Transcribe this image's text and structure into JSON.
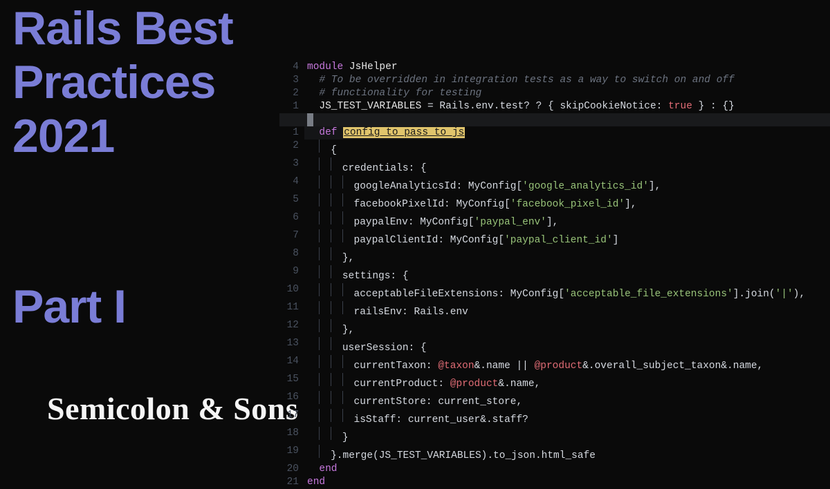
{
  "title": {
    "line1": "Rails Best",
    "line2": "Practices",
    "line3": "2021"
  },
  "part": "Part I",
  "brand": "Semicolon & Sons",
  "code": {
    "module_kw": "module",
    "module_name": " JsHelper",
    "comment1": "  # To be overridden in integration tests as a way to switch on and off",
    "comment2": "  # functionality for testing",
    "const_name": "  JS_TEST_VARIABLES",
    "const_assign": " = Rails.env.test? ? { ",
    "skip_key": "skipCookieNotice:",
    "true_val": " true",
    "const_tail": " } : {}",
    "def_kw": "def",
    "def_name": "config_to_pass_to_js",
    "open_brace": "{",
    "cred_key": "credentials:",
    "brace_open": " {",
    "ga_key": "googleAnalyticsId:",
    "ga_val": " MyConfig[",
    "ga_str": "'google_analytics_id'",
    "fb_key": "facebookPixelId:",
    "fb_str": "'facebook_pixel_id'",
    "pp_key": "paypalEnv:",
    "pp_str": "'paypal_env'",
    "pc_key": "paypalClientId:",
    "pc_str": "'paypal_client_id'",
    "close_brace_c": "},",
    "settings_key": "settings:",
    "afe_key": "acceptableFileExtensions:",
    "afe_str": "'acceptable_file_extensions'",
    "afe_join": "].join(",
    "pipe_str": "'|'",
    "re_key": "railsEnv:",
    "re_val": " Rails.env",
    "us_key": "userSession:",
    "ct_key": "currentTaxon:",
    "taxon_ivar": " @taxon",
    "amp_name": "&.name || ",
    "product_ivar": "@product",
    "overall": "&.overall_subject_taxon&.name,",
    "cp_key": "currentProduct:",
    "product_name": "&.name,",
    "cs_key": "currentStore:",
    "cs_val": " current_store,",
    "is_key": "isStaff:",
    "is_val": " current_user&.staff?",
    "close_brace": "}",
    "merge_line": "}.merge(JS_TEST_VARIABLES).to_json.html_safe",
    "end_kw": "end",
    "gutters_top": [
      "4",
      "3",
      "2",
      "1",
      ""
    ],
    "gutters_fn": [
      "1",
      "2",
      "3",
      "4",
      "5",
      "6",
      "7",
      "8",
      "9",
      "10",
      "11",
      "12",
      "13",
      "14",
      "15",
      "16",
      "17",
      "18",
      "19",
      "20",
      "21"
    ],
    "close_sq_comma": "],",
    "close_sq": "]",
    "close_paren_comma": "),"
  }
}
